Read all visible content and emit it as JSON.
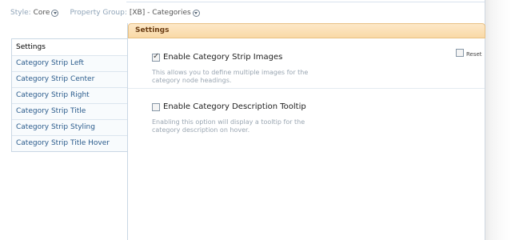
{
  "style_bar": {
    "style_label": "Style:",
    "style_value": "Core",
    "group_label": "Property Group:",
    "group_value": "[XB] - Categories"
  },
  "sidebar": {
    "items": [
      {
        "label": "Settings",
        "active": true
      },
      {
        "label": "Category Strip Left"
      },
      {
        "label": "Category Strip Center"
      },
      {
        "label": "Category Strip Right"
      },
      {
        "label": "Category Strip Title"
      },
      {
        "label": "Category Strip Styling"
      },
      {
        "label": "Category Strip Title Hover"
      }
    ]
  },
  "panel": {
    "title": "Settings",
    "options": [
      {
        "label": "Enable Category Strip Images",
        "checked": true,
        "description": "This allows you to define multiple images for the category node headings."
      },
      {
        "label": "Enable Category Description Tooltip",
        "checked": false,
        "description": "Enabling this option will display a tooltip for the category description on hover."
      }
    ],
    "reset_label": "Reset"
  }
}
